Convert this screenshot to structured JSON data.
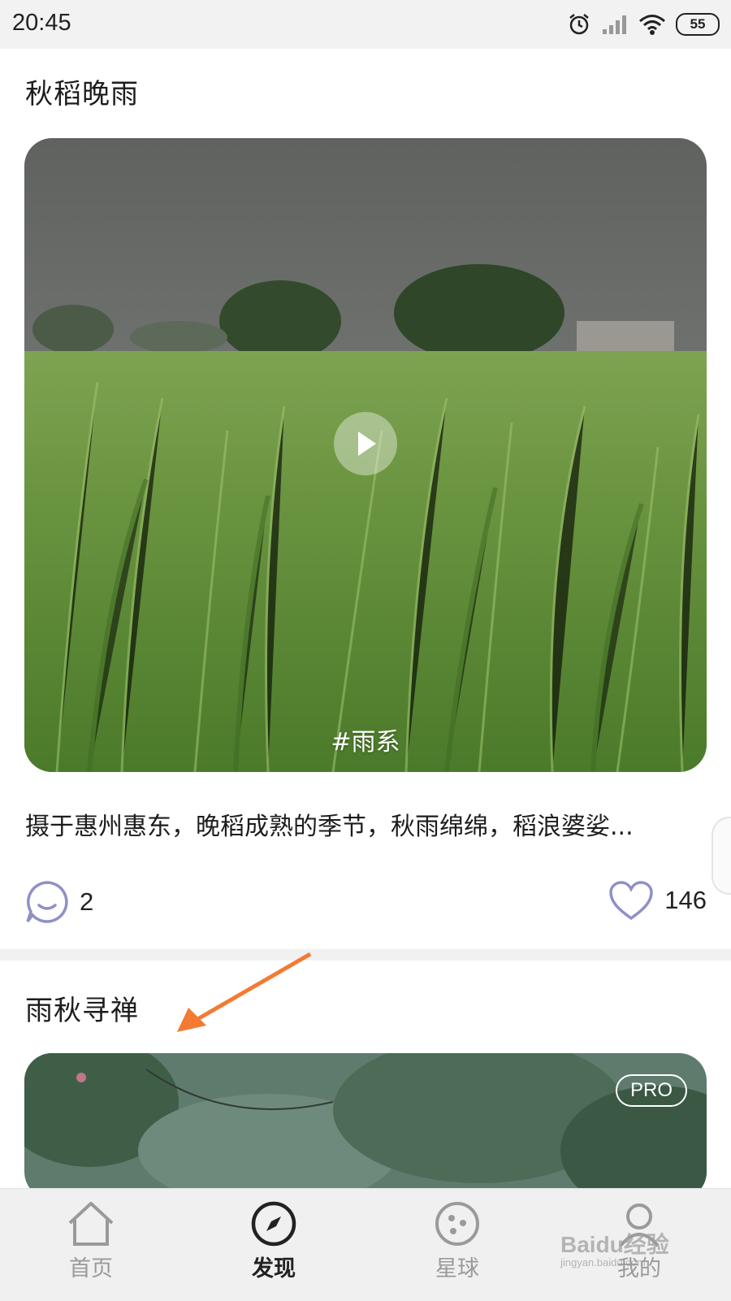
{
  "status_bar": {
    "time": "20:45",
    "battery": "55",
    "icons": [
      "alarm-icon",
      "cellular-signal-icon",
      "wifi-icon",
      "battery-icon"
    ]
  },
  "posts": [
    {
      "title": "秋稻晚雨",
      "tag": "#雨系",
      "description": "摄于惠州惠东，晚稻成熟的季节，秋雨绵绵，稻浪婆娑...",
      "comments": "2",
      "likes": "146"
    },
    {
      "title": "雨秋寻禅",
      "badge": "PRO"
    }
  ],
  "nav": [
    {
      "label": "首页",
      "icon": "home-icon"
    },
    {
      "label": "发现",
      "icon": "compass-icon"
    },
    {
      "label": "星球",
      "icon": "planet-icon"
    },
    {
      "label": "我的",
      "icon": "profile-icon"
    }
  ],
  "watermark": {
    "text": "Baidu经验",
    "sub": "jingyan.baidu.com"
  },
  "colors": {
    "accent_arrow": "#f47a33",
    "icon_outline": "#8f90c8"
  }
}
